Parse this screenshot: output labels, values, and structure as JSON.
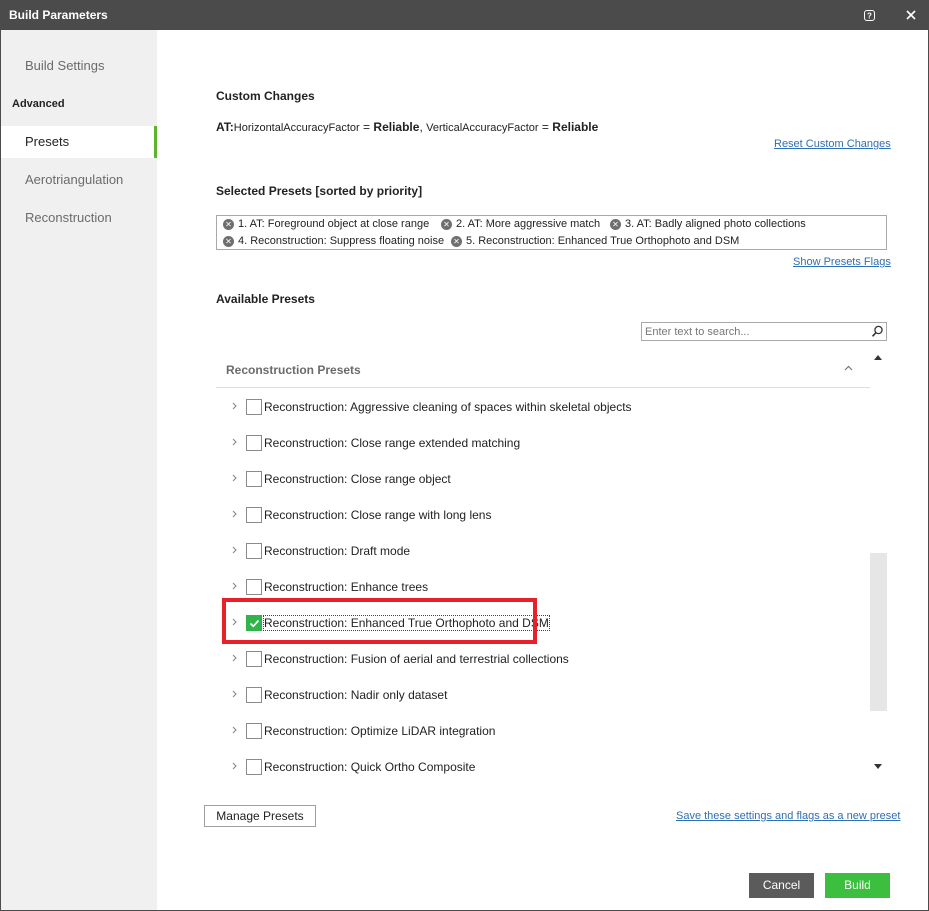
{
  "window": {
    "title": "Build Parameters"
  },
  "sidebar": {
    "build_settings": "Build Settings",
    "section_advanced": "Advanced",
    "items": [
      {
        "label": "Presets",
        "active": true
      },
      {
        "label": "Aerotriangulation",
        "active": false
      },
      {
        "label": "Reconstruction",
        "active": false
      }
    ]
  },
  "custom_changes": {
    "heading": "Custom Changes",
    "prefix": "AT:",
    "key1": "HorizontalAccuracyFactor",
    "eq1": " = ",
    "val1": "Reliable",
    "sep": ", ",
    "key2": "VerticalAccuracyFactor",
    "eq2": " = ",
    "val2": "Reliable",
    "reset_link": "Reset Custom Changes"
  },
  "selected_presets": {
    "heading": "Selected Presets [sorted by priority]",
    "chips": [
      "1. AT: Foreground object at close range",
      "2. AT: More aggressive match",
      "3. AT: Badly aligned photo collections",
      "4. Reconstruction: Suppress floating noise",
      "5. Reconstruction: Enhanced True Orthophoto and DSM"
    ],
    "show_flags_link": "Show Presets Flags"
  },
  "available_presets": {
    "heading": "Available Presets",
    "search_placeholder": "Enter text to search...",
    "group_label": "Reconstruction Presets",
    "items": [
      {
        "label": "Reconstruction: Aggressive cleaning of spaces within skeletal objects",
        "checked": false
      },
      {
        "label": "Reconstruction: Close range extended matching",
        "checked": false
      },
      {
        "label": "Reconstruction: Close range object",
        "checked": false
      },
      {
        "label": "Reconstruction: Close range with long lens",
        "checked": false
      },
      {
        "label": "Reconstruction: Draft mode",
        "checked": false
      },
      {
        "label": "Reconstruction: Enhance trees",
        "checked": false
      },
      {
        "label": "Reconstruction: Enhanced True Orthophoto and DSM",
        "checked": true
      },
      {
        "label": "Reconstruction: Fusion of aerial and terrestrial collections",
        "checked": false
      },
      {
        "label": "Reconstruction: Nadir only dataset",
        "checked": false
      },
      {
        "label": "Reconstruction: Optimize LiDAR integration",
        "checked": false
      },
      {
        "label": "Reconstruction: Quick Ortho Composite",
        "checked": false
      }
    ]
  },
  "footer": {
    "manage_presets": "Manage Presets",
    "save_link": "Save these settings and flags as a new preset",
    "cancel": "Cancel",
    "build": "Build"
  },
  "colors": {
    "titlebar": "#4b4b4b",
    "accent_green": "#3cbf3f",
    "highlight_red": "#e8202a",
    "link_blue": "#2e6fb7"
  }
}
